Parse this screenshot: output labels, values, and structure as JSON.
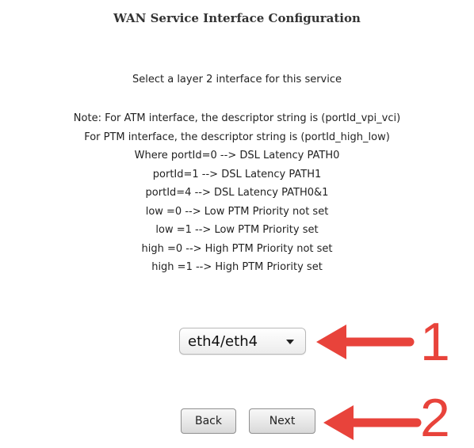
{
  "page": {
    "title": "WAN Service Interface Configuration",
    "subtitle": "Select a layer 2 interface for this service"
  },
  "notes": [
    "Note: For ATM interface, the descriptor string is (portId_vpi_vci)",
    "For PTM interface, the descriptor string is (portId_high_low)",
    "Where portId=0 --> DSL Latency PATH0",
    "portId=1 --> DSL Latency PATH1",
    "portId=4 --> DSL Latency PATH0&1",
    "low =0 --> Low PTM Priority not set",
    "low =1 --> Low PTM Priority set",
    "high =0 --> High PTM Priority not set",
    "high =1 --> High PTM Priority set"
  ],
  "interface_select": {
    "value": "eth4/eth4",
    "icon": "chevron-down-icon"
  },
  "buttons": {
    "back_label": "Back",
    "next_label": "Next"
  },
  "callouts": {
    "color": "#e8433b",
    "step1_label": "1",
    "step2_label": "2",
    "icon": "arrow-left-icon"
  }
}
